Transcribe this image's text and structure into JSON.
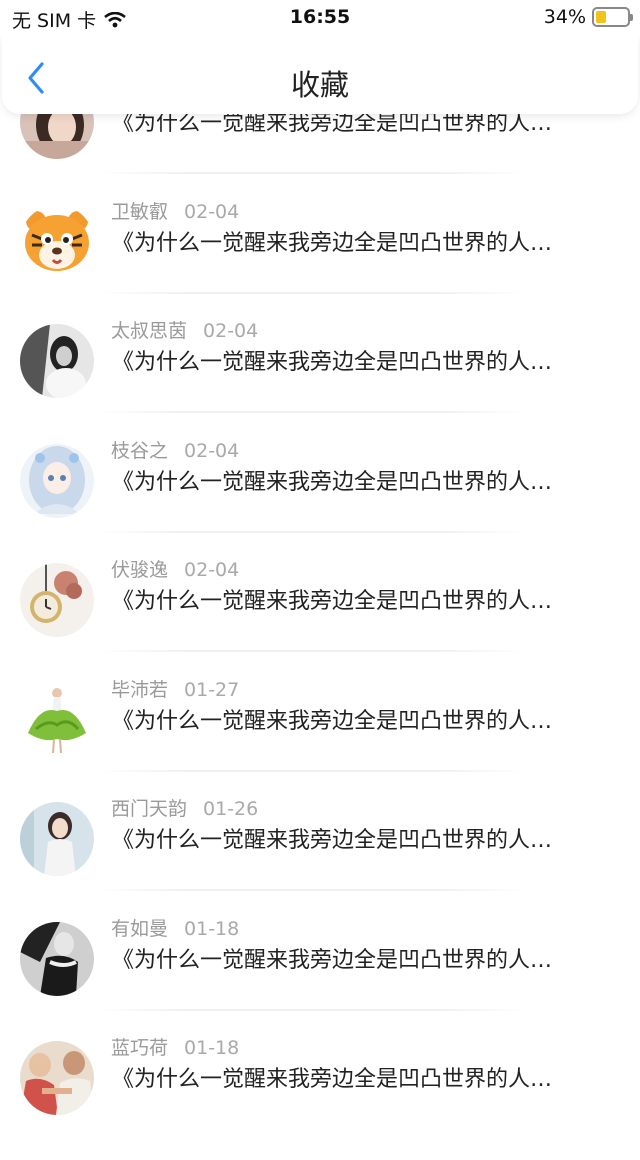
{
  "status_bar": {
    "carrier": "无 SIM 卡",
    "time": "16:55",
    "battery_percent": "34%",
    "battery_level": 0.34,
    "battery_color": "#f2c318"
  },
  "nav": {
    "title": "收藏",
    "back_icon": "chevron-left-icon",
    "accent": "#2e8df5"
  },
  "items": [
    {
      "name": "",
      "date": "",
      "title": "《为什么一觉醒来我旁边全是凹凸世界的人…",
      "avatar": "photo-girl"
    },
    {
      "name": "卫敏叡",
      "date": "02-04",
      "title": "《为什么一觉醒来我旁边全是凹凸世界的人…",
      "avatar": "cartoon-tiger"
    },
    {
      "name": "太叔思茵",
      "date": "02-04",
      "title": "《为什么一觉醒来我旁边全是凹凸世界的人…",
      "avatar": "photo-bw-girl"
    },
    {
      "name": "枝谷之",
      "date": "02-04",
      "title": "《为什么一觉醒来我旁边全是凹凸世界的人…",
      "avatar": "anime-girl"
    },
    {
      "name": "伏骏逸",
      "date": "02-04",
      "title": "《为什么一觉醒来我旁边全是凹凸世界的人…",
      "avatar": "pocket-watch-flower"
    },
    {
      "name": "毕沛若",
      "date": "01-27",
      "title": "《为什么一觉醒来我旁边全是凹凸世界的人…",
      "avatar": "green-dress-girl"
    },
    {
      "name": "西门天韵",
      "date": "01-26",
      "title": "《为什么一觉醒来我旁边全是凹凸世界的人…",
      "avatar": "photo-girl-light"
    },
    {
      "name": "有如曼",
      "date": "01-18",
      "title": "《为什么一觉醒来我旁边全是凹凸世界的人…",
      "avatar": "photo-bw-woman"
    },
    {
      "name": "蓝巧荷",
      "date": "01-18",
      "title": "《为什么一觉醒来我旁边全是凹凸世界的人…",
      "avatar": "photo-two-kids"
    }
  ]
}
